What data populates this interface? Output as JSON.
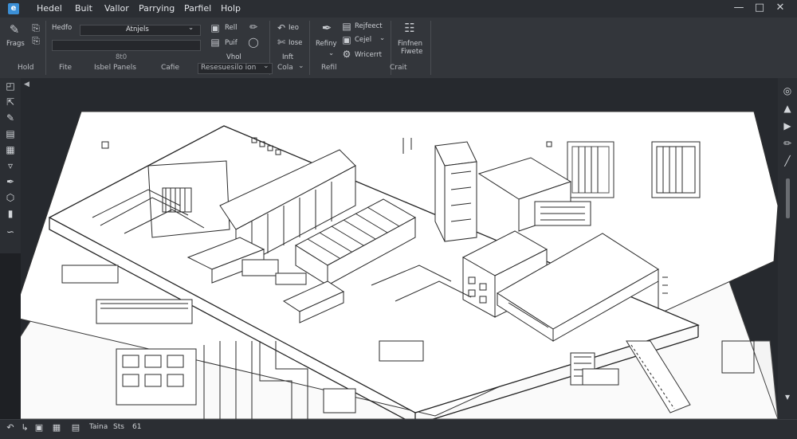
{
  "menu": {
    "items": [
      "Hedel",
      "Buit",
      "Vallor",
      "Parrying",
      "Parfiel",
      "Holp"
    ]
  },
  "ribbon": {
    "home": {
      "big_label": "Frags",
      "group_label": "Hold"
    },
    "file": {
      "layer_label": "Hedfo",
      "layer_value": "Atnjels",
      "scale_value": "8t0",
      "group_label": "Fite"
    },
    "label_panels": {
      "group_label": "Isbel Panels"
    },
    "cable": {
      "group_label": "Cafie"
    },
    "resource": {
      "dropdown_value": "Resesuesilo ion"
    },
    "view": {
      "btn1": "Rell",
      "btn2": "Puif",
      "btn3": "Vhol"
    },
    "cola": {
      "btn1": "Ieo",
      "btn2": "Iose",
      "btn3": "Inft",
      "group_label": "Cola"
    },
    "refill": {
      "big_label": "Refiny",
      "group_label": "Refil"
    },
    "object": {
      "btn1": "Rejfeect",
      "btn2": "Cejel",
      "btn3": "Wricerrt"
    },
    "create": {
      "big_label_line1": "Finfnen",
      "big_label_line2": "Fiwete",
      "group_label": "Crait"
    }
  },
  "statusbar": {
    "text1": "Taina",
    "text2": "Sts",
    "text3": "61"
  },
  "colors": {
    "accent": "#3b8fd6",
    "chrome": "#2b2e33",
    "ribbon": "#33363b",
    "viewport": "#26292e",
    "paper": "#ffffff",
    "ink": "#2a2a2a"
  },
  "icons": {
    "left_toolbar": [
      "select-icon",
      "move-icon",
      "edit-icon",
      "layers-icon",
      "grid-icon",
      "measure-icon",
      "pen-icon",
      "shape-icon",
      "fill-icon",
      "curve-icon"
    ],
    "right_toolbar": [
      "globe-icon",
      "paint-icon",
      "play-icon",
      "pencil-icon",
      "line-icon"
    ]
  }
}
